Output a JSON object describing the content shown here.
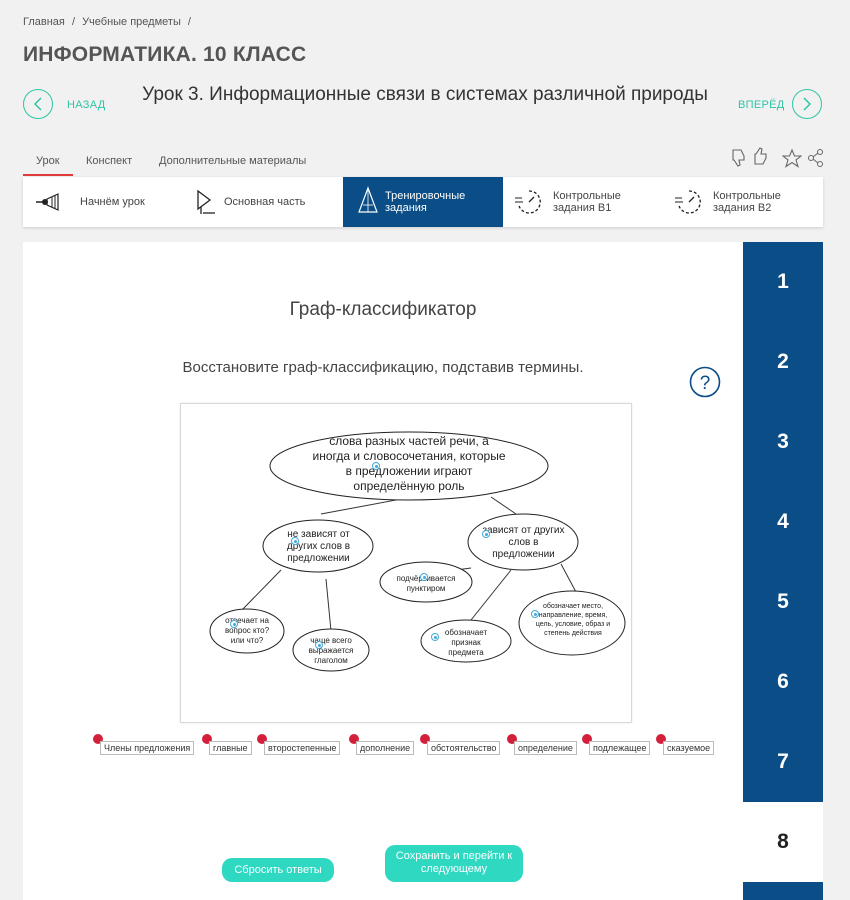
{
  "breadcrumb": {
    "home": "Главная",
    "subjects": "Учебные предметы",
    "sep": "/"
  },
  "page_title": "ИНФОРМАТИКА. 10 КЛАСС",
  "nav": {
    "back": "НАЗАД",
    "forward": "ВПЕРЁД"
  },
  "lesson_title": "Урок 3. Информационные связи в системах различной природы",
  "tabs": [
    "Урок",
    "Конспект",
    "Дополнительные материалы"
  ],
  "steps": [
    {
      "label": "Начнём урок",
      "icon": "megaphone-icon"
    },
    {
      "label": "Основная часть",
      "icon": "play-icon"
    },
    {
      "label": "Тренировочные задания",
      "icon": "compass-icon",
      "active": true
    },
    {
      "label": "Контрольные задания В1",
      "icon": "timer-icon"
    },
    {
      "label": "Контрольные задания В2",
      "icon": "timer-icon"
    }
  ],
  "task": {
    "title": "Граф-классификатор",
    "instruction": "Восстановите граф-классификацию, подставив термины."
  },
  "graph": {
    "nodes": [
      "слова разных частей речи, а иногда и словосочетания, которые в предложении играют определённую роль",
      "не зависят от других слов в предложении",
      "зависят от других слов в предложении",
      "отвечает на вопрос кто? или что?",
      "чаще всего выражается глаголом",
      "подчёркивается пунктиром",
      "обозначает признак предмета",
      "обозначает место, направление, время, цель, условие, образ и степень действия"
    ]
  },
  "terms": [
    "Члены предложения",
    "главные",
    "второстепенные",
    "дополнение",
    "обстоятельство",
    "определение",
    "подлежащее",
    "сказуемое"
  ],
  "buttons": {
    "reset": "Сбросить ответы",
    "save": "Сохранить и перейти к следующему"
  },
  "task_numbers": [
    "1",
    "2",
    "3",
    "4",
    "5",
    "6",
    "7",
    "8"
  ],
  "current_task": "8",
  "colors": {
    "accent": "#2ec4a6",
    "navy": "#0b4d86",
    "button": "#2ed8c1",
    "marker": "#d41f3b",
    "tab_underline": "#e03a3a"
  }
}
